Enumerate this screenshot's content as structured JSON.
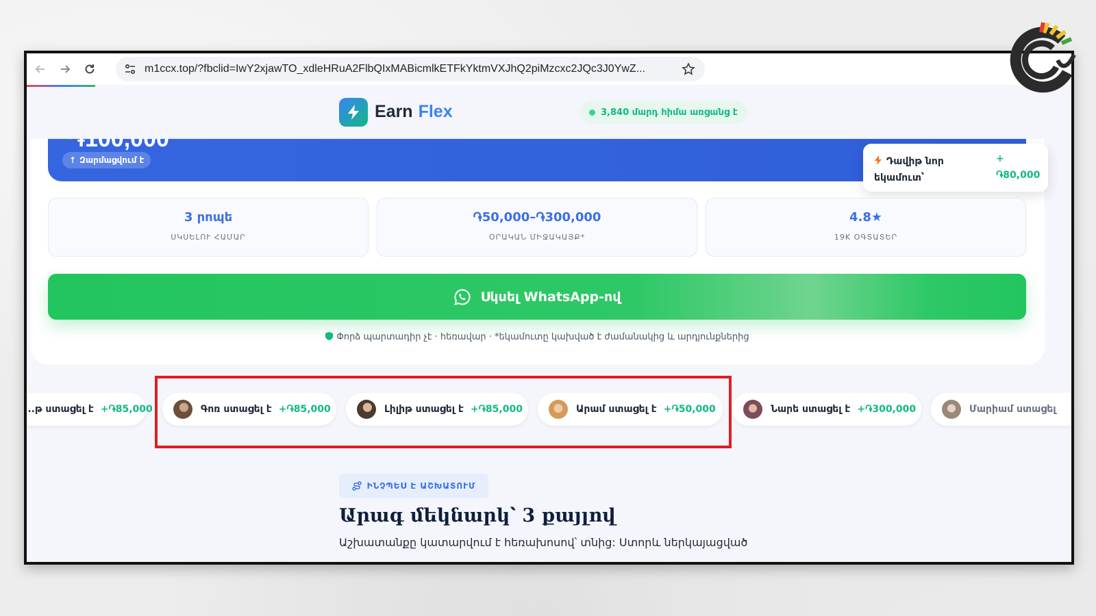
{
  "browser": {
    "url": "m1ccx.top/?fbclid=IwY2xjawTO_xdleHRuA2FlbQIxMABicmlkETFkYktmVXJhQ2piMzcxc2JQc3J0YwZ..."
  },
  "header": {
    "brand_first": "Earn",
    "brand_second": "Flex",
    "live_text": "3,840 մարդ հիմա առցանց է"
  },
  "hero": {
    "big_number": "֏100,000",
    "growing_badge": "Զարմացվում է",
    "new_income_label": "Դավիթ նոր եկամուտ՝",
    "new_income_plus": "+",
    "new_income_amount": "֏80,000"
  },
  "stats": [
    {
      "value": "3 րոպե",
      "label": "ՍԿՍԵԼՈՒ ՀԱՄԱՐ"
    },
    {
      "value": "֏50,000–֏300,000",
      "label": "ՕՐԱԿԱՆ ՄԻՋԱԿԱՅՔ*"
    },
    {
      "value": "4.8★",
      "label": "19K ՕԳՏԱՏԵՐ"
    }
  ],
  "cta": {
    "label": "Սկսել WhatsApp-ով"
  },
  "disclaimer": "Փորձ պարտադիր չէ · հեռավար · *եկամուտը կախված է ժամանակից և արդյունքներից",
  "ticker": [
    {
      "name": "...թ ստացել է",
      "amount": "+֏85,000",
      "avatar_color": "#b08968"
    },
    {
      "name": "Գոռ ստացել է",
      "amount": "+֏85,000",
      "avatar_color": "#6b4f3a"
    },
    {
      "name": "Լիլիթ ստացել է",
      "amount": "+֏85,000",
      "avatar_color": "#5a4636"
    },
    {
      "name": "Արամ ստացել է",
      "amount": "+֏50,000",
      "avatar_color": "#d4a373"
    },
    {
      "name": "Նարե ստացել է",
      "amount": "+֏300,000",
      "avatar_color": "#8e5b68"
    },
    {
      "name": "Մարիամ ստացել",
      "amount": "",
      "avatar_color": "#9c8878"
    }
  ],
  "section": {
    "pill": "ԻՆՉՊԵՍ Է ԱՇԽԱՏՈՒՄ",
    "title": "Արագ մեկնարկ՝ 3 քայլով",
    "subtitle": "Աշխատանքը կատարվում է հեռախոսով՝ տնից: Ստորև ներկայացված"
  },
  "colors": {
    "accent_blue": "#3b6fe6",
    "accent_green": "#10b981",
    "cta_green": "#22c55e",
    "highlight_red": "#e11d24"
  }
}
